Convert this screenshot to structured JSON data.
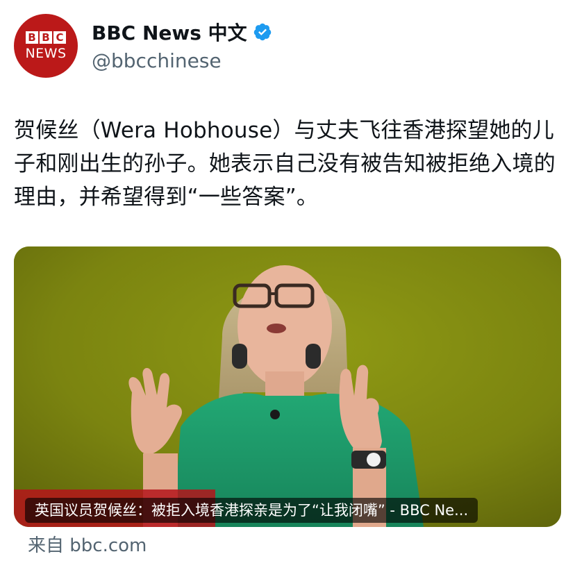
{
  "account": {
    "avatar_logo_letters": [
      "B",
      "B",
      "C"
    ],
    "avatar_logo_subtitle": "NEWS",
    "display_name": "BBC News 中文",
    "handle": "@bbcchinese",
    "verified": true,
    "verified_icon": "verified-badge-icon",
    "brand_color": "#bb1919",
    "verified_color": "#1d9bf0"
  },
  "post": {
    "text": "贺候丝（Wera Hobhouse）与丈夫飞往香港探望她的儿子和刚出生的孙子。她表示自己没有被告知被拒绝入境的理由，并希望得到“一些答案”。"
  },
  "link_card": {
    "title": "英国议员贺候丝：被拒入境香港探亲是为了“让我闭嘴” - BBC Ne...",
    "image_description_colors": {
      "background": "#7d8410",
      "top": "#8a9612",
      "shirt": "#1f9a6a"
    }
  },
  "source": {
    "prefix": "来自",
    "domain": "bbc.com"
  }
}
